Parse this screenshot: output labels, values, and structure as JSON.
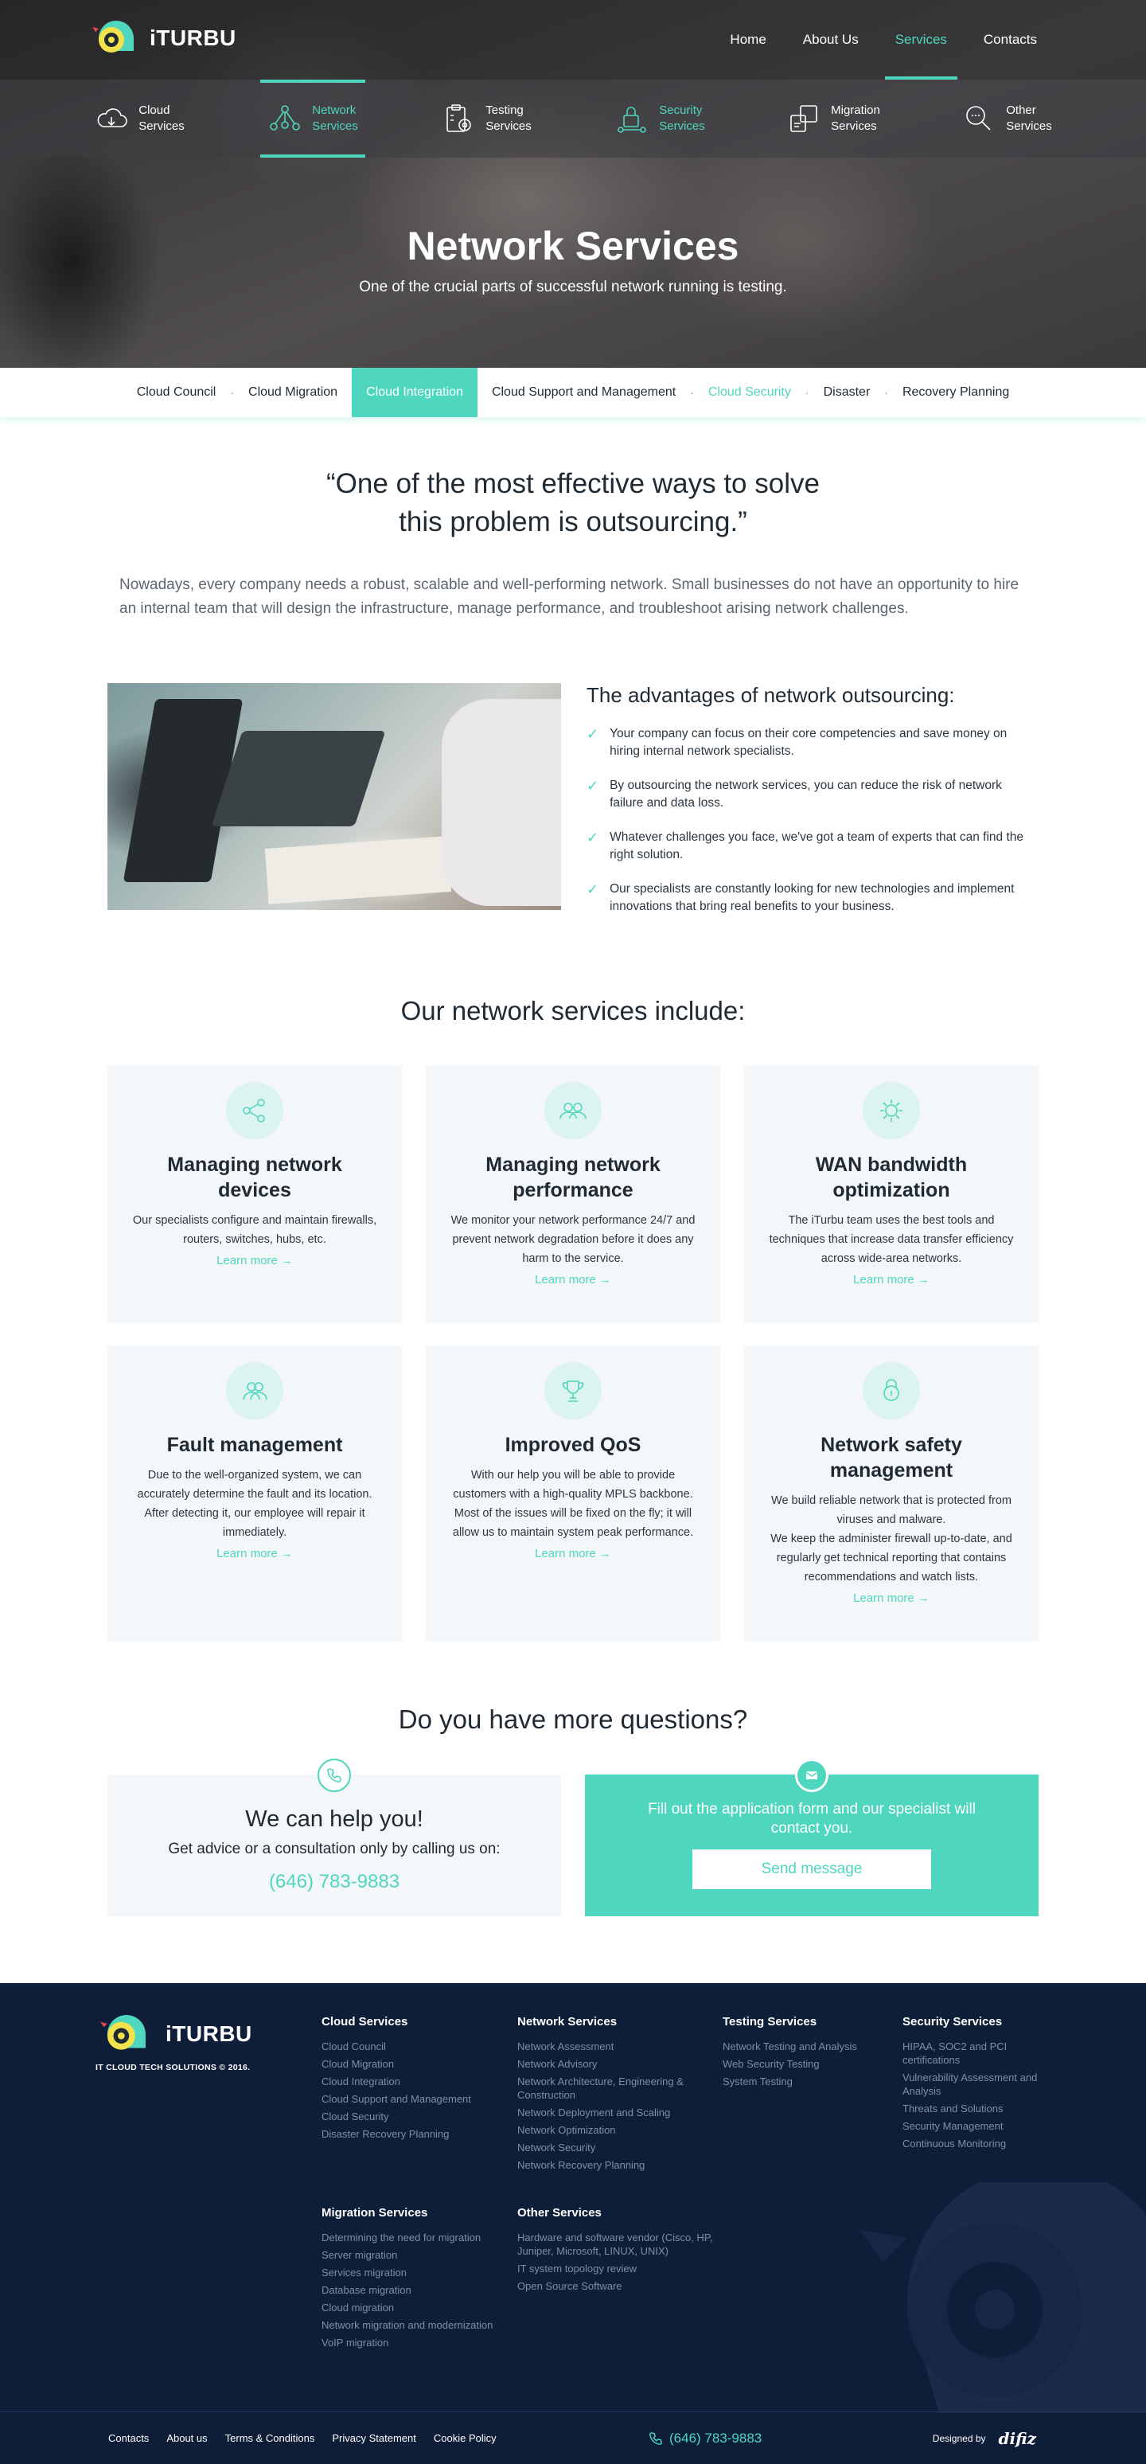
{
  "brand": {
    "name": "iTURBU",
    "copyright": "IT CLOUD TECH SOLUTIONS © 2016."
  },
  "colors": {
    "accent": "#4fd6be",
    "footer_bg": "#0e1e38",
    "card_bg": "#f4f7fa"
  },
  "main_nav": [
    {
      "label": "Home"
    },
    {
      "label": "About Us"
    },
    {
      "label": "Services",
      "active": true
    },
    {
      "label": "Contacts"
    }
  ],
  "service_nav": [
    {
      "line1": "Cloud",
      "line2": "Services",
      "icon": "cloud-icon"
    },
    {
      "line1": "Network",
      "line2": "Services",
      "icon": "network-icon",
      "active": true
    },
    {
      "line1": "Testing",
      "line2": "Services",
      "icon": "clipboard-gear-icon"
    },
    {
      "line1": "Security",
      "line2": "Services",
      "icon": "lock-network-icon",
      "hover": true
    },
    {
      "line1": "Migration",
      "line2": "Services",
      "icon": "migration-icon"
    },
    {
      "line1": "Other",
      "line2": "Services",
      "icon": "search-icon"
    }
  ],
  "hero": {
    "title": "Network Services",
    "subtitle": "One of the crucial parts of successful network running is testing."
  },
  "tabs": [
    {
      "label": "Cloud Council"
    },
    {
      "label": "Cloud Migration"
    },
    {
      "label": "Cloud Integration",
      "active": true
    },
    {
      "label": "Cloud Support and Management"
    },
    {
      "label": "Cloud Security",
      "hover": true
    },
    {
      "label": "Disaster"
    },
    {
      "label": "Recovery Planning"
    }
  ],
  "quote": {
    "line1": "“One of the most effective ways to solve",
    "line2": "this problem is outsourcing.”"
  },
  "intro": "Nowadays, every company needs a robust, scalable and well-performing network. Small businesses do not have an opportunity to hire an internal team that will design the infrastructure, manage performance, and troubleshoot arising network challenges.",
  "advantages": {
    "title": "The advantages of network outsourcing:",
    "items": [
      "Your company can focus on their core competencies and save money on hiring internal network specialists.",
      "By outsourcing the network services, you can reduce the risk of network failure and data loss.",
      "Whatever challenges you face, we've got a team of experts that can find the right solution.",
      "Our specialists are constantly looking for new technologies and implement innovations that bring real benefits to your business."
    ]
  },
  "services": {
    "title": "Our network services include:",
    "learn_more": "Learn more →",
    "cards": [
      {
        "title": "Managing network devices",
        "icon": "share-icon",
        "text": "Our specialists configure and maintain firewalls, routers, switches, hubs, etc."
      },
      {
        "title": "Managing network performance",
        "icon": "team-icon",
        "text": "We monitor your network performance 24/7 and prevent network degradation before it does any harm to the service."
      },
      {
        "title": "WAN bandwidth optimization",
        "icon": "gear-icon",
        "text": "The iTurbu team uses the best tools and techniques that increase data transfer efficiency across wide-area networks."
      },
      {
        "title": "Fault management",
        "icon": "users-icon",
        "text": "Due to the well-organized system, we can accurately determine the fault and its location. After detecting it, our employee will repair it immediately."
      },
      {
        "title": "Improved QoS",
        "icon": "trophy-icon",
        "text": "With our help you will be able to provide customers with a high-quality MPLS backbone. Most of the issues will be fixed on the fly; it will allow us to maintain system peak performance."
      },
      {
        "title": "Network safety management",
        "icon": "lock-icon",
        "text": "We build reliable network that is protected from viruses and malware.\nWe keep the administer firewall up-to-date, and regularly get technical reporting that contains recommendations and watch lists."
      }
    ]
  },
  "questions": {
    "title": "Do you have more questions?",
    "call": {
      "heading": "We can help you!",
      "sub": "Get advice or a consultation only by calling us on:",
      "phone": "(646) 783-9883"
    },
    "form": {
      "text": "Fill out the application form and our specialist will contact you.",
      "button": "Send message"
    }
  },
  "footer": {
    "columns": [
      {
        "title": "Cloud Services",
        "links": [
          "Cloud Council",
          "Cloud Migration",
          "Cloud Integration",
          "Cloud Support and Management",
          "Cloud Security",
          "Disaster Recovery Planning"
        ]
      },
      {
        "title": "Network Services",
        "links": [
          "Network Assessment",
          "Network Advisory",
          "Network Architecture, Engineering & Construction",
          "Network Deployment and Scaling",
          "Network Optimization",
          "Network Security",
          "Network Recovery Planning"
        ]
      },
      {
        "title": "Testing Services",
        "links": [
          "Network Testing and Analysis",
          "Web Security Testing",
          "System Testing"
        ]
      },
      {
        "title": "Security Services",
        "links": [
          "HIPAA, SOC2 and PCI certifications",
          "Vulnerability Assessment and Analysis",
          "Threats and Solutions",
          "Security Management",
          "Continuous Monitoring"
        ]
      },
      {
        "title": "Migration Services",
        "links": [
          "Determining the need for migration",
          "Server migration",
          "Services migration",
          "Database migration",
          "Cloud migration",
          "Network migration and modernization",
          "VoIP migration"
        ]
      },
      {
        "title": "Other Services",
        "links": [
          "Hardware and software vendor (Cisco, HP, Juniper, Microsoft, LINUX, UNIX)",
          "IT system topology review",
          "Open Source Software"
        ]
      }
    ],
    "bottom_links": [
      "Contacts",
      "About us",
      "Terms & Conditions",
      "Privacy Statement",
      "Cookie Policy"
    ],
    "phone": "(646) 783-9883",
    "designed_by": "Designed by",
    "designer": "difiz"
  }
}
